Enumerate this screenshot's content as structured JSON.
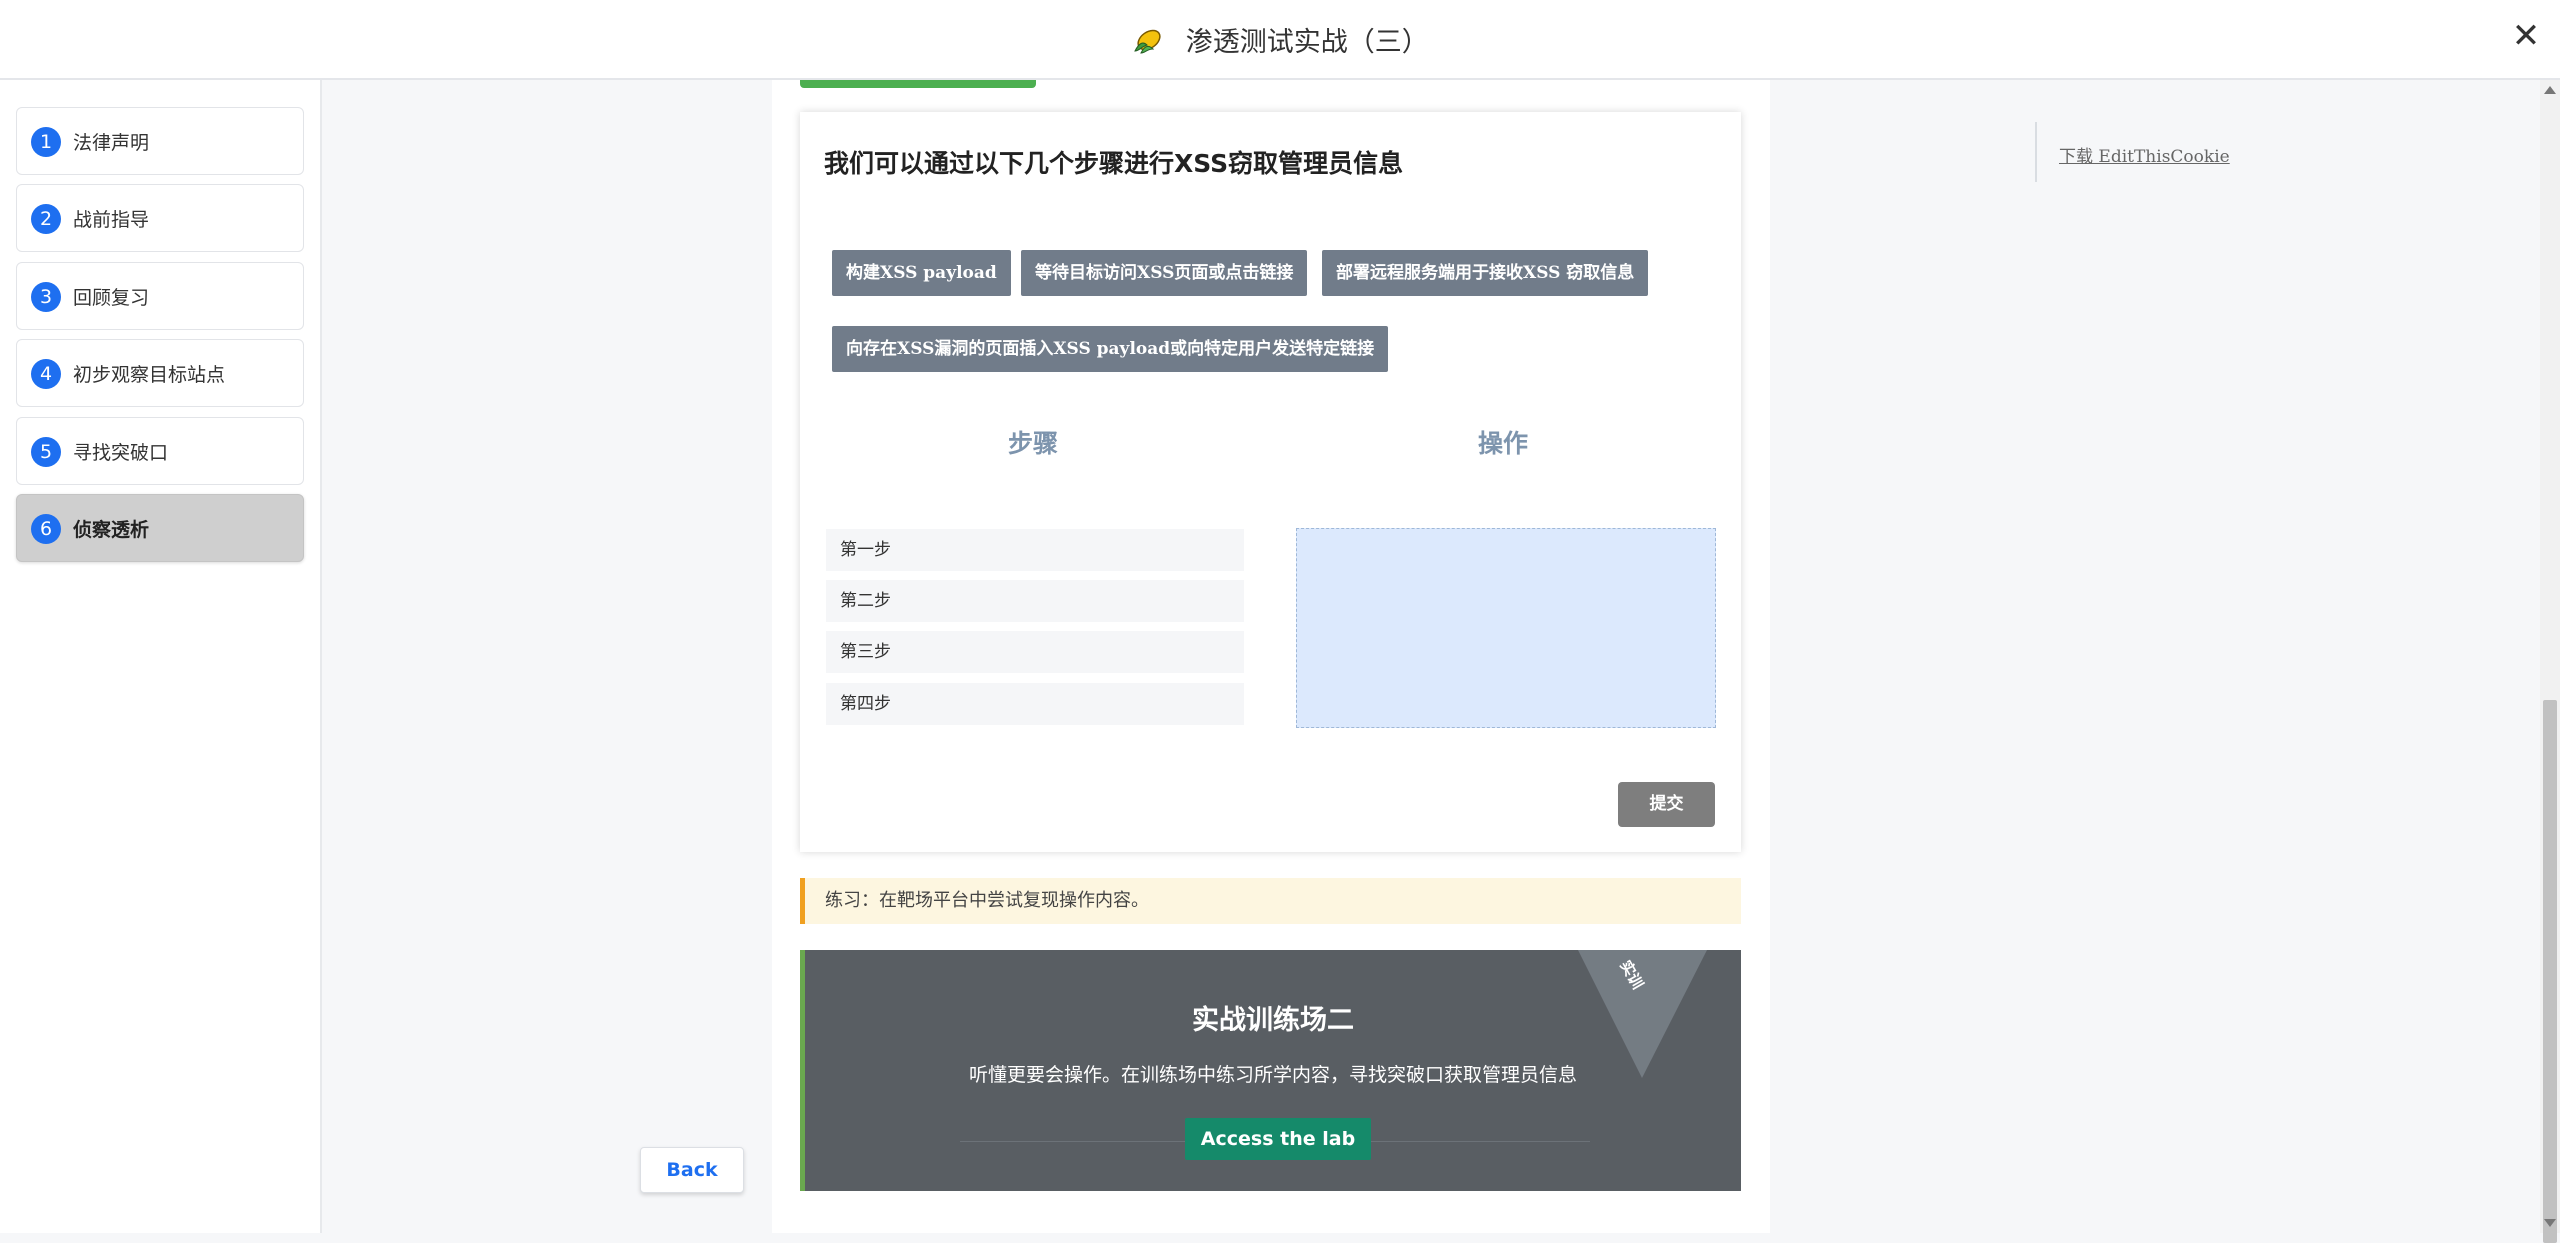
{
  "header": {
    "title": "渗透测试实战（三）",
    "logo_icon": "corn-logo-icon",
    "close_icon": "close-icon",
    "close_glyph": "✕"
  },
  "sidebar": {
    "items": [
      {
        "num": "1",
        "label": "法律声明"
      },
      {
        "num": "2",
        "label": "战前指导"
      },
      {
        "num": "3",
        "label": "回顾复习"
      },
      {
        "num": "4",
        "label": "初步观察目标站点"
      },
      {
        "num": "5",
        "label": "寻找突破口"
      },
      {
        "num": "6",
        "label": "侦察透析"
      }
    ],
    "active_index": 5,
    "accent_color": "#1e6ff0"
  },
  "back_button": {
    "label": "Back"
  },
  "exercise": {
    "title": "我们可以通过以下几个步骤进行XSS窃取管理员信息",
    "chips": [
      "构建XSS payload",
      "等待目标访问XSS页面或点击链接",
      "部署远程服务端用于接收XSS 窃取信息",
      "向存在XSS漏洞的页面插入XSS payload或向特定用户发送特定链接"
    ],
    "steps_header": "步骤",
    "ops_header": "操作",
    "steps": [
      "第一步",
      "第二步",
      "第三步",
      "第四步"
    ],
    "submit_label": "提交"
  },
  "notice": {
    "text": "练习：在靶场平台中尝试复现操作内容。"
  },
  "lab": {
    "title": "实战训练场二",
    "description": "听懂更要会操作。在训练场中练习所学内容，寻找突破口获取管理员信息",
    "button_label": "Access the lab",
    "ribbon_text": "实训",
    "button_color": "#158a6a"
  },
  "right_panel": {
    "link_text": "下载 EditThisCookie"
  }
}
